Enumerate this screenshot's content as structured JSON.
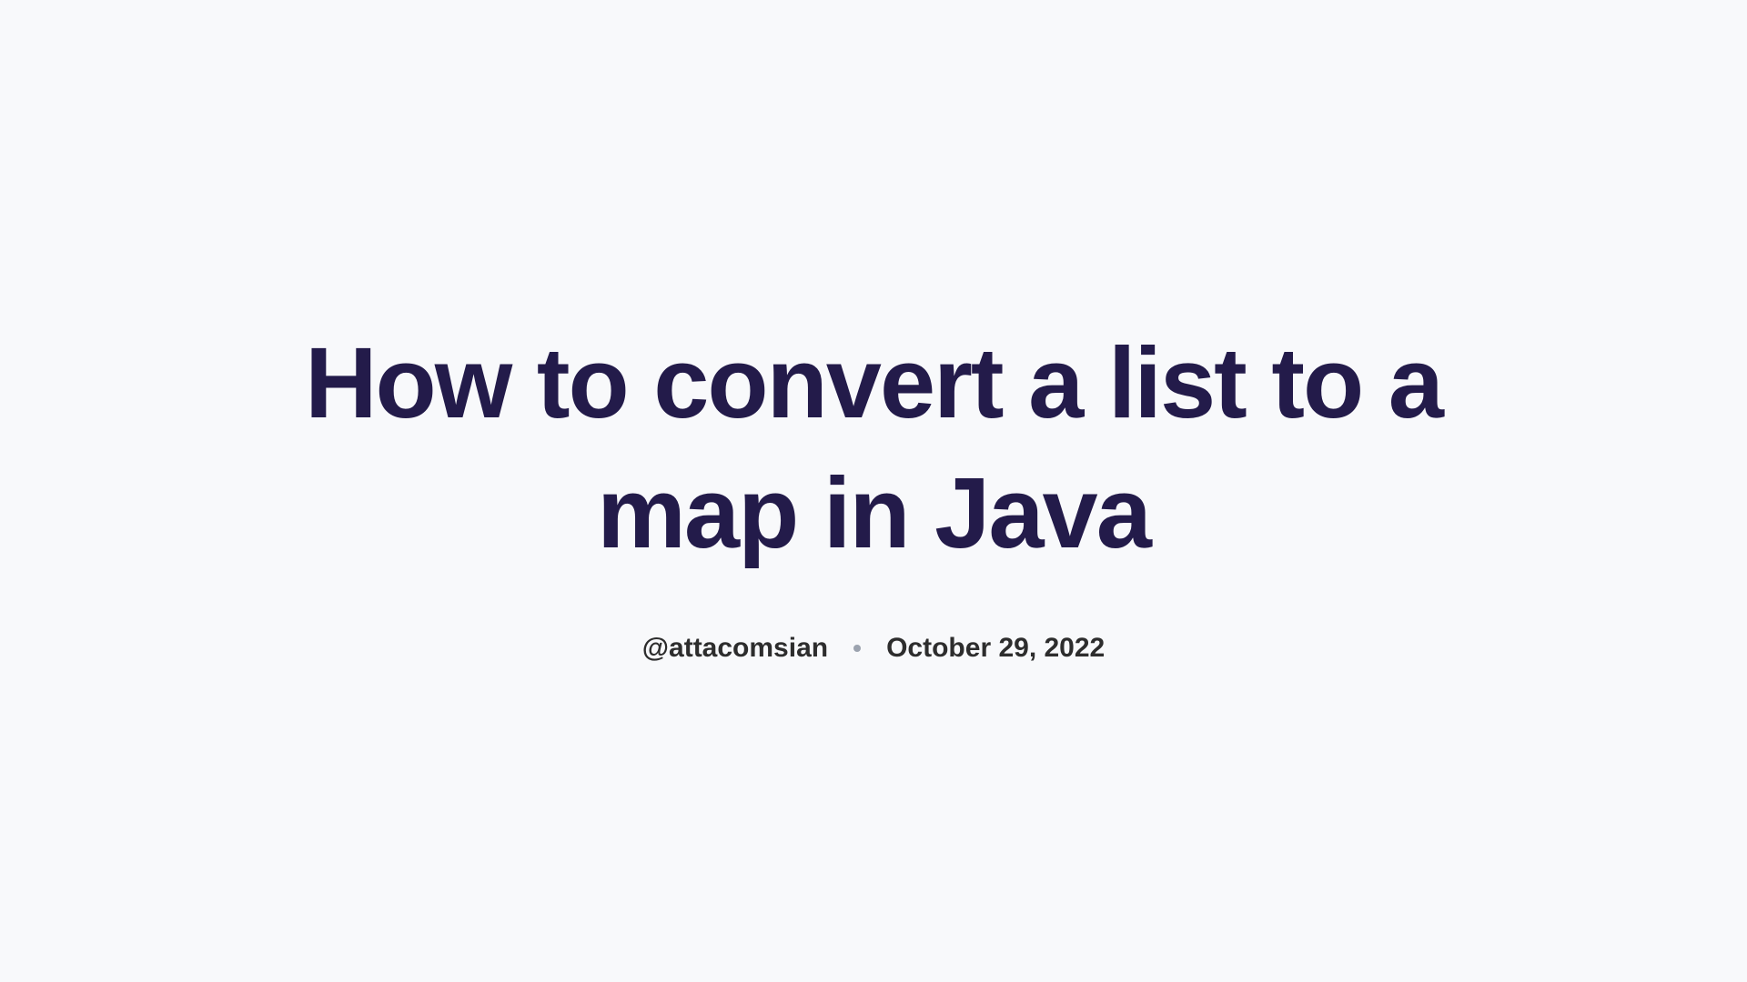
{
  "title": "How to convert a list to a map in Java",
  "author": "@attacomsian",
  "date": "October 29, 2022"
}
